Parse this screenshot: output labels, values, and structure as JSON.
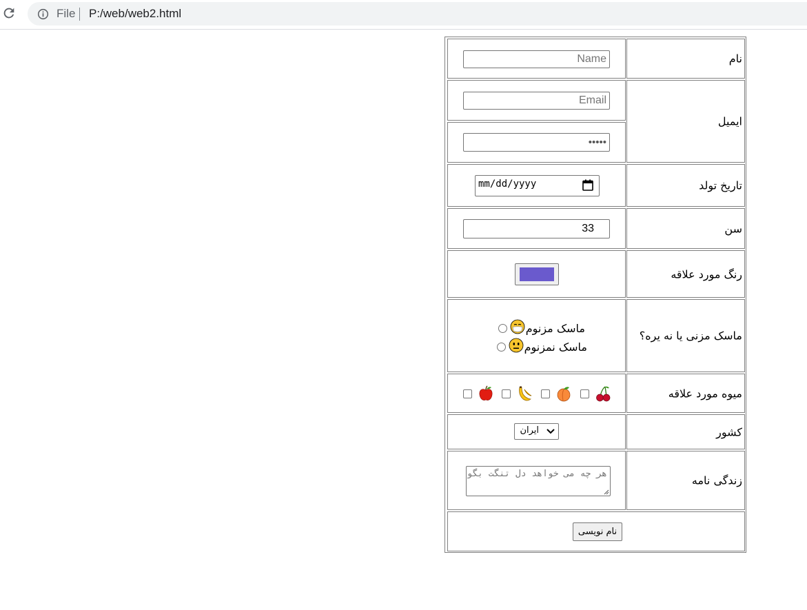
{
  "browser": {
    "scheme_label": "File",
    "url": "P:/web/web2.html"
  },
  "form": {
    "name": {
      "label": "نام",
      "placeholder": "Name"
    },
    "email": {
      "label": "ایمیل",
      "placeholder": "Email",
      "password_dots": "•••••"
    },
    "birthdate": {
      "label": "تاریخ تولد",
      "value": "mm/dd/yyyy"
    },
    "age": {
      "label": "سن",
      "value": "33"
    },
    "fav_color": {
      "label": "رنگ مورد علاقه",
      "value": "#6a5acd"
    },
    "mask": {
      "label": "ماسک مزنی یا نه یره؟",
      "options": [
        {
          "text": "ماسک مزنوم",
          "emoji": "😷",
          "checked": false
        },
        {
          "text": "ماسک نمزنوم",
          "emoji": "😐",
          "checked": false
        }
      ]
    },
    "fruits": {
      "label": "میوه مورد علاقه",
      "items": [
        {
          "name": "cherries",
          "emoji": "🍒",
          "checked": false
        },
        {
          "name": "peach",
          "emoji": "🍑",
          "checked": false
        },
        {
          "name": "banana",
          "emoji": "🍌",
          "checked": false
        },
        {
          "name": "apple",
          "emoji": "🍎",
          "checked": false
        }
      ]
    },
    "country": {
      "label": "کشور",
      "selected": "ایران"
    },
    "bio": {
      "label": "زندگی نامه",
      "placeholder": "هر چه می خواهد دل تنگت بگو"
    },
    "submit": {
      "label": "نام نویسی"
    }
  }
}
